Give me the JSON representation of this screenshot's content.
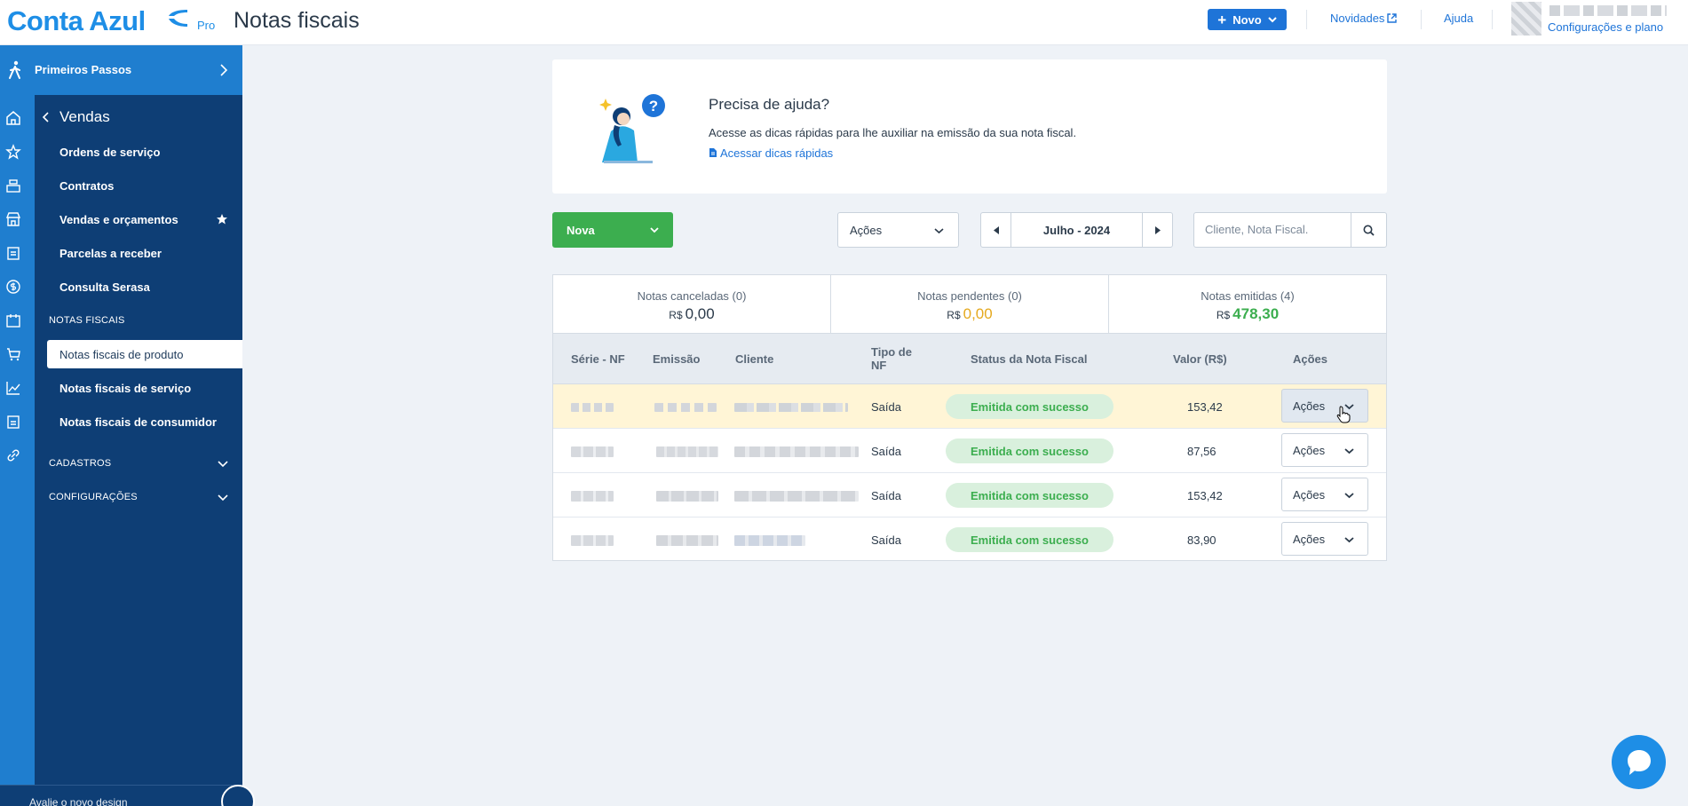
{
  "app": {
    "logo": "Conta Azul",
    "logo_badge": "Pro",
    "page_title": "Notas fiscais"
  },
  "topbar": {
    "novo_label": "Novo",
    "novidades_label": "Novidades",
    "ajuda_label": "Ajuda",
    "user_plan_link": "Configurações e plano"
  },
  "sidebar": {
    "primeiros_passos": "Primeiros Passos",
    "section_title": "Vendas",
    "items": [
      {
        "label": "Ordens de serviço"
      },
      {
        "label": "Contratos"
      },
      {
        "label": "Vendas e orçamentos"
      },
      {
        "label": "Parcelas a receber"
      },
      {
        "label": "Consulta Serasa"
      }
    ],
    "notas_fiscais_header": "NOTAS FISCAIS",
    "notas_items": [
      {
        "label": "Notas fiscais de produto",
        "active": true
      },
      {
        "label": "Notas fiscais de serviço"
      },
      {
        "label": "Notas fiscais de consumidor"
      }
    ],
    "cadastros": "CADASTROS",
    "configuracoes": "CONFIGURAÇÕES",
    "bottom_text": "Avalie o novo design"
  },
  "help": {
    "title": "Precisa de ajuda?",
    "text": "Acesse as dicas rápidas para lhe auxiliar na emissão da sua nota fiscal.",
    "link": "Acessar dicas rápidas"
  },
  "toolbar": {
    "nova_label": "Nova",
    "acoes_label": "Ações",
    "month_label": "Julho - 2024",
    "search_placeholder": "Cliente, Nota Fiscal."
  },
  "summary": {
    "currency": "R$",
    "canceladas_label": "Notas canceladas (0)",
    "canceladas_value": "0,00",
    "pendentes_label": "Notas pendentes (0)",
    "pendentes_value": "0,00",
    "emitidas_label": "Notas emitidas (4)",
    "emitidas_value": "478,30"
  },
  "table": {
    "headers": {
      "serie": "Série - NF",
      "emissao": "Emissão",
      "cliente": "Cliente",
      "tipo": "Tipo de NF",
      "status": "Status da Nota Fiscal",
      "valor": "Valor (R$)",
      "acoes": "Ações"
    },
    "rows": [
      {
        "tipo": "Saída",
        "status": "Emitida com sucesso",
        "valor": "153,42",
        "acoes": "Ações"
      },
      {
        "tipo": "Saída",
        "status": "Emitida com sucesso",
        "valor": "87,56",
        "acoes": "Ações"
      },
      {
        "tipo": "Saída",
        "status": "Emitida com sucesso",
        "valor": "153,42",
        "acoes": "Ações"
      },
      {
        "tipo": "Saída",
        "status": "Emitida com sucesso",
        "valor": "83,90",
        "acoes": "Ações"
      }
    ]
  },
  "colors": {
    "brand": "#1e8ee6",
    "sidebar": "#0e3e75",
    "success": "#3cae4f",
    "warning": "#e5a91e"
  }
}
